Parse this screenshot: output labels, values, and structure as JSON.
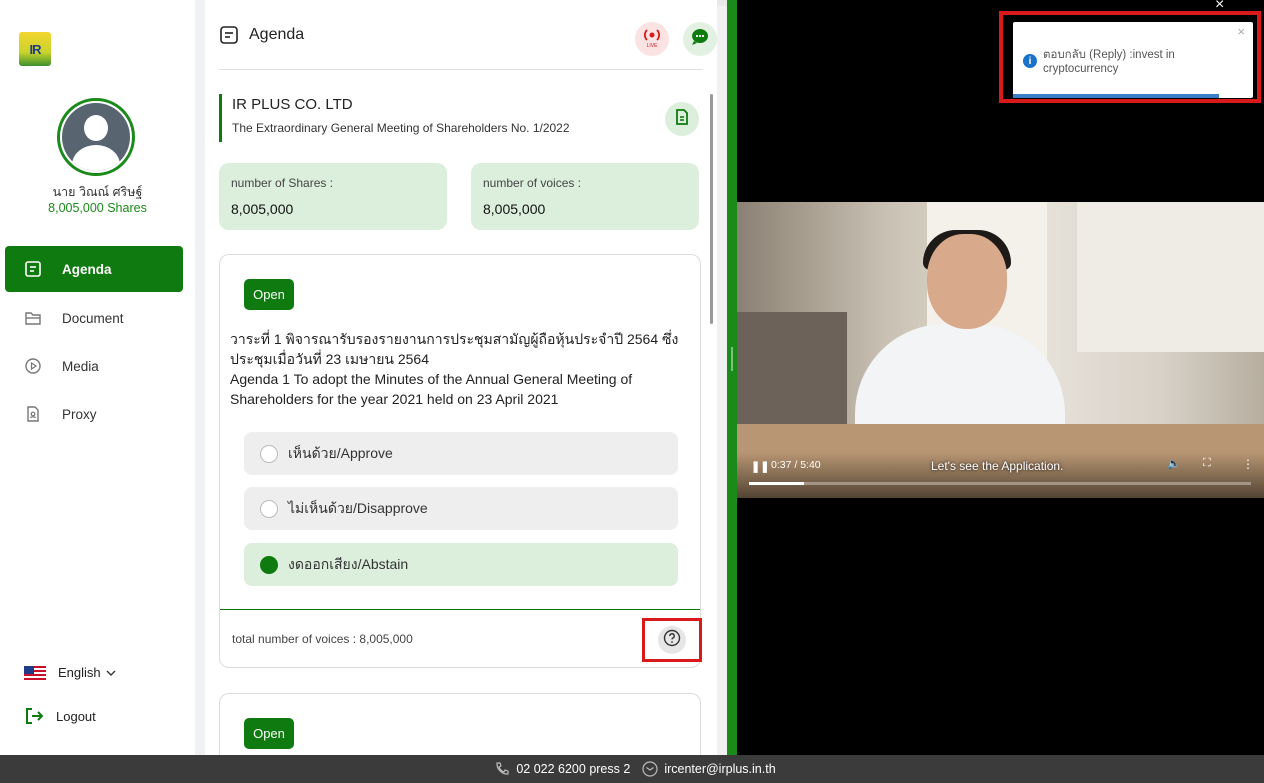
{
  "sidebar": {
    "user": {
      "name": "นาย วิณณ์ ศริษฐ์",
      "shares": "8,005,000 Shares"
    },
    "nav": [
      {
        "label": "Agenda",
        "icon": "agenda-icon",
        "active": true
      },
      {
        "label": "Document",
        "icon": "folder-icon",
        "active": false
      },
      {
        "label": "Media",
        "icon": "play-circle-icon",
        "active": false
      },
      {
        "label": "Proxy",
        "icon": "proxy-document-icon",
        "active": false
      }
    ],
    "language": "English",
    "logout": "Logout"
  },
  "agenda": {
    "title": "Agenda",
    "company_name": "IR PLUS CO. LTD",
    "meeting_name": "The Extraordinary General Meeting of Shareholders No. 1/2022",
    "shares_label": "number of Shares :",
    "shares_value": "8,005,000",
    "voices_label": "number of voices :",
    "voices_value": "8,005,000",
    "items": [
      {
        "status": "Open",
        "text_th": "วาระที่ 1 พิจารณารับรองรายงานการประชุมสามัญผู้ถือหุ้นประจำปี 2564 ซึ่งประชุมเมื่อวันที่ 23 เมษายน 2564",
        "text_en": "Agenda 1 To adopt the Minutes of the Annual General Meeting of Shareholders for the year 2021 held on 23 April 2021",
        "options": [
          {
            "label": "เห็นด้วย/Approve",
            "selected": false
          },
          {
            "label": "ไม่เห็นด้วย/Disapprove",
            "selected": false
          },
          {
            "label": "งดออกเสียง/Abstain",
            "selected": true
          }
        ],
        "total_voices": "total number of voices : 8,005,000"
      },
      {
        "status": "Open"
      }
    ]
  },
  "video": {
    "time": "0:37 / 5:40",
    "subtitle": "Let's see the Application.",
    "progress": 0.109
  },
  "toast": {
    "message": "ตอบกลับ (Reply) :invest in cryptocurrency"
  },
  "footer": {
    "phone": "02 022 6200 press 2",
    "email": "ircenter@irplus.in.th"
  },
  "colors": {
    "brand_green": "#0f7a0f",
    "light_green": "#dcefdc",
    "highlight_red": "#d91a1a",
    "footer_bg": "#3b3b3b"
  }
}
